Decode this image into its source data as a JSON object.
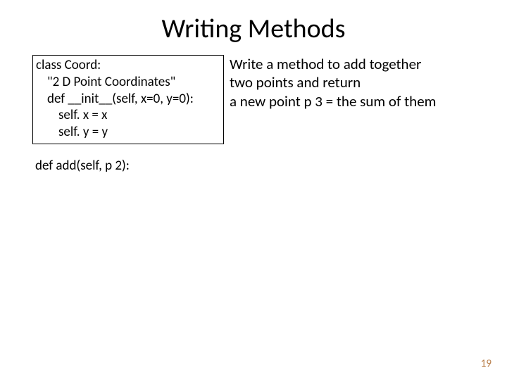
{
  "title": "Writing Methods",
  "code": {
    "l1": "class Coord:",
    "l2": "\"2 D Point Coordinates\"",
    "l3": "def __init__(self, x=0, y=0):",
    "l4": "self. x = x",
    "l5": "self. y = y"
  },
  "instructions": {
    "l1": "Write a method to add together",
    "l2": "two points and return",
    "l3": "a new point p 3 = the sum of them"
  },
  "method_line": "def add(self, p 2):",
  "page_number": "19"
}
